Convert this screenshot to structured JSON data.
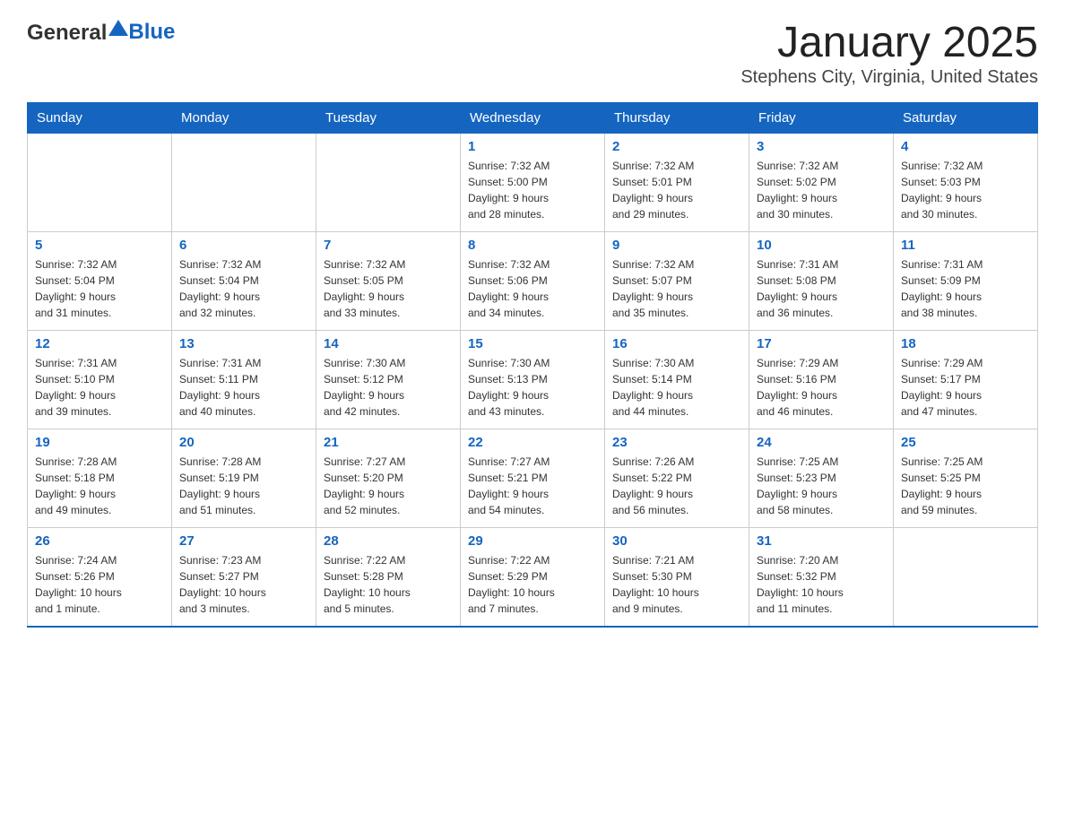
{
  "header": {
    "logo": {
      "general": "General",
      "arrow": "▲",
      "blue": "Blue"
    },
    "title": "January 2025",
    "subtitle": "Stephens City, Virginia, United States"
  },
  "weekdays": [
    "Sunday",
    "Monday",
    "Tuesday",
    "Wednesday",
    "Thursday",
    "Friday",
    "Saturday"
  ],
  "weeks": [
    [
      {
        "day": "",
        "info": ""
      },
      {
        "day": "",
        "info": ""
      },
      {
        "day": "",
        "info": ""
      },
      {
        "day": "1",
        "info": "Sunrise: 7:32 AM\nSunset: 5:00 PM\nDaylight: 9 hours\nand 28 minutes."
      },
      {
        "day": "2",
        "info": "Sunrise: 7:32 AM\nSunset: 5:01 PM\nDaylight: 9 hours\nand 29 minutes."
      },
      {
        "day": "3",
        "info": "Sunrise: 7:32 AM\nSunset: 5:02 PM\nDaylight: 9 hours\nand 30 minutes."
      },
      {
        "day": "4",
        "info": "Sunrise: 7:32 AM\nSunset: 5:03 PM\nDaylight: 9 hours\nand 30 minutes."
      }
    ],
    [
      {
        "day": "5",
        "info": "Sunrise: 7:32 AM\nSunset: 5:04 PM\nDaylight: 9 hours\nand 31 minutes."
      },
      {
        "day": "6",
        "info": "Sunrise: 7:32 AM\nSunset: 5:04 PM\nDaylight: 9 hours\nand 32 minutes."
      },
      {
        "day": "7",
        "info": "Sunrise: 7:32 AM\nSunset: 5:05 PM\nDaylight: 9 hours\nand 33 minutes."
      },
      {
        "day": "8",
        "info": "Sunrise: 7:32 AM\nSunset: 5:06 PM\nDaylight: 9 hours\nand 34 minutes."
      },
      {
        "day": "9",
        "info": "Sunrise: 7:32 AM\nSunset: 5:07 PM\nDaylight: 9 hours\nand 35 minutes."
      },
      {
        "day": "10",
        "info": "Sunrise: 7:31 AM\nSunset: 5:08 PM\nDaylight: 9 hours\nand 36 minutes."
      },
      {
        "day": "11",
        "info": "Sunrise: 7:31 AM\nSunset: 5:09 PM\nDaylight: 9 hours\nand 38 minutes."
      }
    ],
    [
      {
        "day": "12",
        "info": "Sunrise: 7:31 AM\nSunset: 5:10 PM\nDaylight: 9 hours\nand 39 minutes."
      },
      {
        "day": "13",
        "info": "Sunrise: 7:31 AM\nSunset: 5:11 PM\nDaylight: 9 hours\nand 40 minutes."
      },
      {
        "day": "14",
        "info": "Sunrise: 7:30 AM\nSunset: 5:12 PM\nDaylight: 9 hours\nand 42 minutes."
      },
      {
        "day": "15",
        "info": "Sunrise: 7:30 AM\nSunset: 5:13 PM\nDaylight: 9 hours\nand 43 minutes."
      },
      {
        "day": "16",
        "info": "Sunrise: 7:30 AM\nSunset: 5:14 PM\nDaylight: 9 hours\nand 44 minutes."
      },
      {
        "day": "17",
        "info": "Sunrise: 7:29 AM\nSunset: 5:16 PM\nDaylight: 9 hours\nand 46 minutes."
      },
      {
        "day": "18",
        "info": "Sunrise: 7:29 AM\nSunset: 5:17 PM\nDaylight: 9 hours\nand 47 minutes."
      }
    ],
    [
      {
        "day": "19",
        "info": "Sunrise: 7:28 AM\nSunset: 5:18 PM\nDaylight: 9 hours\nand 49 minutes."
      },
      {
        "day": "20",
        "info": "Sunrise: 7:28 AM\nSunset: 5:19 PM\nDaylight: 9 hours\nand 51 minutes."
      },
      {
        "day": "21",
        "info": "Sunrise: 7:27 AM\nSunset: 5:20 PM\nDaylight: 9 hours\nand 52 minutes."
      },
      {
        "day": "22",
        "info": "Sunrise: 7:27 AM\nSunset: 5:21 PM\nDaylight: 9 hours\nand 54 minutes."
      },
      {
        "day": "23",
        "info": "Sunrise: 7:26 AM\nSunset: 5:22 PM\nDaylight: 9 hours\nand 56 minutes."
      },
      {
        "day": "24",
        "info": "Sunrise: 7:25 AM\nSunset: 5:23 PM\nDaylight: 9 hours\nand 58 minutes."
      },
      {
        "day": "25",
        "info": "Sunrise: 7:25 AM\nSunset: 5:25 PM\nDaylight: 9 hours\nand 59 minutes."
      }
    ],
    [
      {
        "day": "26",
        "info": "Sunrise: 7:24 AM\nSunset: 5:26 PM\nDaylight: 10 hours\nand 1 minute."
      },
      {
        "day": "27",
        "info": "Sunrise: 7:23 AM\nSunset: 5:27 PM\nDaylight: 10 hours\nand 3 minutes."
      },
      {
        "day": "28",
        "info": "Sunrise: 7:22 AM\nSunset: 5:28 PM\nDaylight: 10 hours\nand 5 minutes."
      },
      {
        "day": "29",
        "info": "Sunrise: 7:22 AM\nSunset: 5:29 PM\nDaylight: 10 hours\nand 7 minutes."
      },
      {
        "day": "30",
        "info": "Sunrise: 7:21 AM\nSunset: 5:30 PM\nDaylight: 10 hours\nand 9 minutes."
      },
      {
        "day": "31",
        "info": "Sunrise: 7:20 AM\nSunset: 5:32 PM\nDaylight: 10 hours\nand 11 minutes."
      },
      {
        "day": "",
        "info": ""
      }
    ]
  ]
}
